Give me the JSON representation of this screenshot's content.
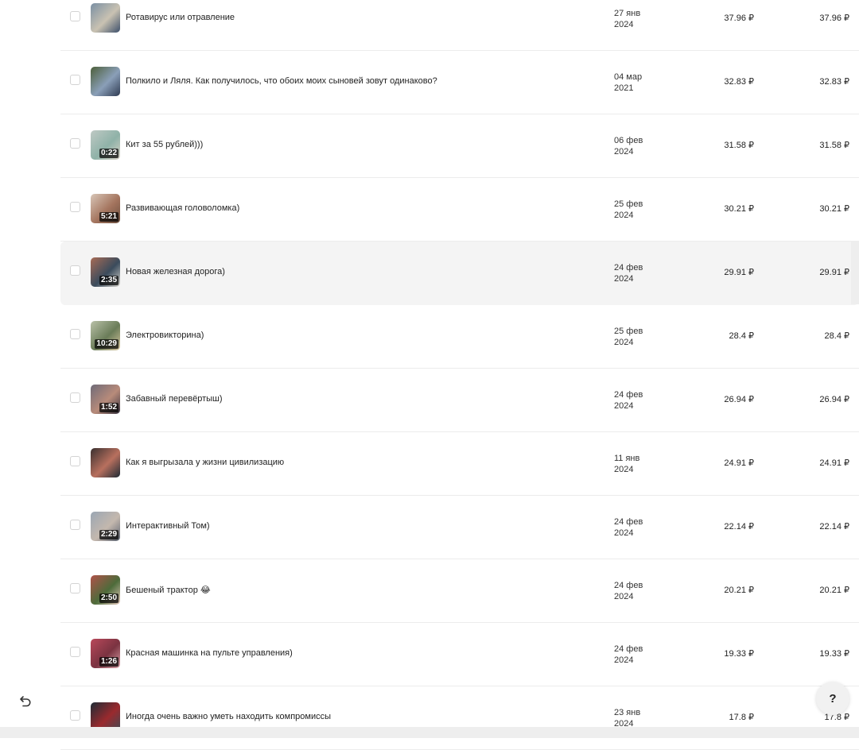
{
  "rows": [
    {
      "title": "Ротавирус или отравление",
      "date_day": "27 янв",
      "date_year": "2024",
      "amount1": "37.96 ₽",
      "amount2": "37.96 ₽",
      "duration": "",
      "thumb_colors": [
        "#7a8fa3",
        "#c9c2b2",
        "#3d4f6a"
      ]
    },
    {
      "title": "Полкило и Ляля. Как получилось, что обоих моих сыновей зовут одинаково?",
      "date_day": "04 мар",
      "date_year": "2021",
      "amount1": "32.83 ₽",
      "amount2": "32.83 ₽",
      "duration": "",
      "thumb_colors": [
        "#4d5f3a",
        "#8a9fb8",
        "#2f3b52"
      ]
    },
    {
      "title": "Кит за 55 рублей)))",
      "date_day": "06 фев",
      "date_year": "2024",
      "amount1": "31.58 ₽",
      "amount2": "31.58 ₽",
      "duration": "0:22",
      "thumb_colors": [
        "#bfc9c4",
        "#8fb2a8",
        "#d8d2c6"
      ]
    },
    {
      "title": "Развивающая головоломка)",
      "date_day": "25 фев",
      "date_year": "2024",
      "amount1": "30.21 ₽",
      "amount2": "30.21 ₽",
      "duration": "5:21",
      "thumb_colors": [
        "#d8c6b8",
        "#a4745e",
        "#6b4e3e"
      ]
    },
    {
      "title": "Новая железная дорога)",
      "date_day": "24 фев",
      "date_year": "2024",
      "amount1": "29.91 ₽",
      "amount2": "29.91 ₽",
      "duration": "2:35",
      "thumb_colors": [
        "#a86b55",
        "#3a4b5c",
        "#d6d3cc"
      ]
    },
    {
      "title": "Электровикторина)",
      "date_day": "25 фев",
      "date_year": "2024",
      "amount1": "28.4 ₽",
      "amount2": "28.4 ₽",
      "duration": "10:29",
      "thumb_colors": [
        "#b9c1a8",
        "#6a7c58",
        "#d9c8a0"
      ]
    },
    {
      "title": "Забавный перевёртыш)",
      "date_day": "24 фев",
      "date_year": "2024",
      "amount1": "26.94 ₽",
      "amount2": "26.94 ₽",
      "duration": "1:52",
      "thumb_colors": [
        "#6e6a78",
        "#b88b7a",
        "#3b3542"
      ]
    },
    {
      "title": "Как я выгрызала у жизни цивилизацию",
      "date_day": "11 янв",
      "date_year": "2024",
      "amount1": "24.91 ₽",
      "amount2": "24.91 ₽",
      "duration": "",
      "thumb_colors": [
        "#3a3030",
        "#b8705e",
        "#1f2a34"
      ]
    },
    {
      "title": "Интерактивный Том)",
      "date_day": "24 фев",
      "date_year": "2024",
      "amount1": "22.14 ₽",
      "amount2": "22.14 ₽",
      "duration": "2:29",
      "thumb_colors": [
        "#9aa6b3",
        "#c4b8ae",
        "#5a6270"
      ]
    },
    {
      "title": "Бешеный трактор 😂",
      "date_day": "24 фев",
      "date_year": "2024",
      "amount1": "20.21 ₽",
      "amount2": "20.21 ₽",
      "duration": "2:50",
      "thumb_colors": [
        "#b0524a",
        "#4d6b3a",
        "#e2c7b9"
      ]
    },
    {
      "title": "Красная машинка на пульте управления)",
      "date_day": "24 фев",
      "date_year": "2024",
      "amount1": "19.33 ₽",
      "amount2": "19.33 ₽",
      "duration": "1:26",
      "thumb_colors": [
        "#b9485a",
        "#7a3341",
        "#d9a0a8"
      ]
    },
    {
      "title": "Иногда очень важно уметь находить компромиссы",
      "date_day": "23 янв",
      "date_year": "2024",
      "amount1": "17.8 ₽",
      "amount2": "17.8 ₽",
      "duration": "",
      "thumb_colors": [
        "#1e2c36",
        "#9a2a2e",
        "#3d4a55"
      ]
    }
  ],
  "help_label": "?",
  "undo_icon": "undo-arrow-icon",
  "hover_row_index": 4
}
